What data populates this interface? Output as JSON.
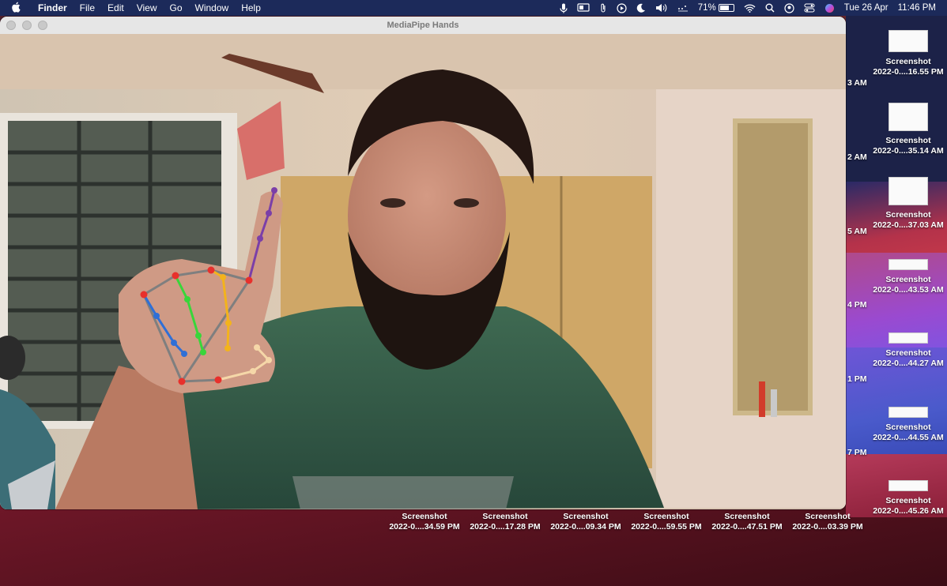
{
  "menubar": {
    "app_name": "Finder",
    "menus": [
      "File",
      "Edit",
      "View",
      "Go",
      "Window",
      "Help"
    ],
    "battery": "71%",
    "battery_level": 0.71,
    "date": "Tue 26 Apr",
    "time": "11:46 PM"
  },
  "window": {
    "title": "MediaPipe Hands"
  },
  "desktop_right_column": [
    {
      "name": "Screenshot",
      "detail": "2022-0....16.55 PM",
      "cut": "3 AM"
    },
    {
      "name": "Screenshot",
      "detail": "2022-0....35.14 AM",
      "cut": "2 AM"
    },
    {
      "name": "Screenshot",
      "detail": "2022-0....37.03 AM",
      "cut": "5 AM"
    },
    {
      "name": "Screenshot",
      "detail": "2022-0....43.53 AM",
      "cut": "4 PM"
    },
    {
      "name": "Screenshot",
      "detail": "2022-0....44.27 AM",
      "cut": "1 PM"
    },
    {
      "name": "Screenshot",
      "detail": "2022-0....44.55 AM",
      "cut": "7 PM"
    },
    {
      "name": "Screenshot",
      "detail": "2022-0....45.26 AM",
      "cut": ""
    }
  ],
  "desktop_bottom_row": [
    {
      "name": "Screenshot",
      "detail": "2022-0....34.59 PM"
    },
    {
      "name": "Screenshot",
      "detail": "2022-0....17.28 PM"
    },
    {
      "name": "Screenshot",
      "detail": "2022-0....09.34 PM"
    },
    {
      "name": "Screenshot",
      "detail": "2022-0....59.55 PM"
    },
    {
      "name": "Screenshot",
      "detail": "2022-0....47.51 PM"
    },
    {
      "name": "Screenshot",
      "detail": "2022-0....03.39 PM"
    }
  ],
  "colors": {
    "menubar": "#1c2a5a",
    "landmark_red": "#e8302c",
    "thumb_line": "#f5d7a8",
    "index_line": "#7b3fa8",
    "middle_line": "#f3b31c",
    "ring_line": "#39d63a",
    "pinky_line": "#2f6fd6",
    "palm_line": "#7f7f7f"
  }
}
